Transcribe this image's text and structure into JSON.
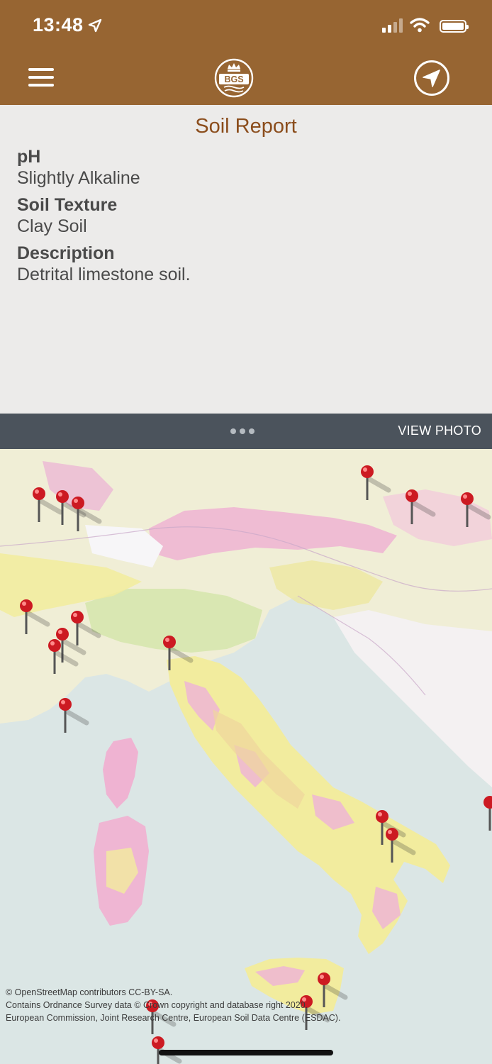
{
  "status_bar": {
    "time": "13:48"
  },
  "header": {
    "logo_text": "BGS",
    "menu_icon": "hamburger-menu-icon",
    "locate_icon": "navigation-arrow-icon"
  },
  "report": {
    "title": "Soil Report",
    "fields": [
      {
        "label": "pH",
        "value": "Slightly Alkaline"
      },
      {
        "label": "Soil Texture",
        "value": "Clay Soil"
      },
      {
        "label": "Description",
        "value": "Detrital limestone soil."
      }
    ]
  },
  "drawer": {
    "view_photo_label": "VIEW PHOTO"
  },
  "map": {
    "attribution": [
      "© OpenStreetMap contributors CC-BY-SA.",
      "Contains Ordnance Survey data © Crown copyright and database right 2020.",
      "European Commission, Joint Research Centre, European Soil Data Centre (ESDAC)."
    ],
    "pin_color": "#cc1a22"
  },
  "colors": {
    "header_brown": "#976532",
    "title_brown": "#8b4d1c",
    "drawer_gray": "#4b535c"
  }
}
